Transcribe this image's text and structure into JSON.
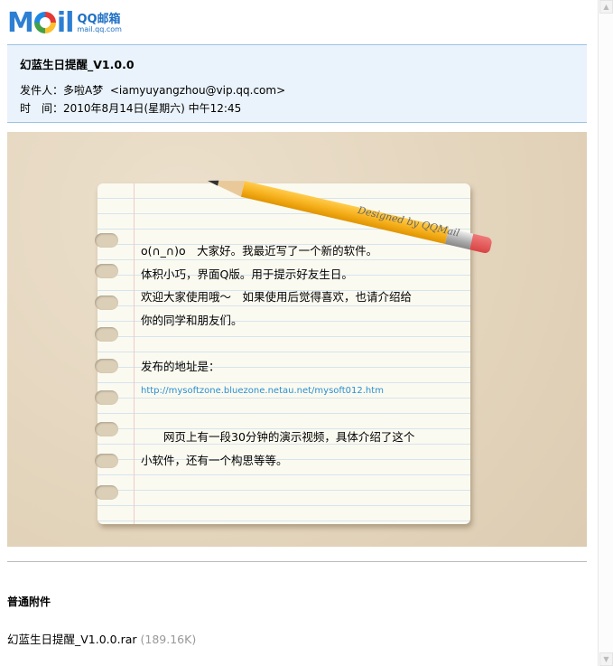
{
  "logo": {
    "brand": "Mail",
    "product": "QQ邮箱",
    "url": "mail.qq.com"
  },
  "email": {
    "subject": "幻蓝生日提醒_V1.0.0",
    "from_label": "发件人：",
    "from_name": "多啦A梦",
    "from_addr": "<iamyuyangzhou@vip.qq.com>",
    "time_label": "时　间：",
    "time_value": "2010年8月14日(星期六) 中午12:45"
  },
  "stationery": {
    "signature": "Designed by QQMail"
  },
  "body": {
    "line1": "o(∩_∩)o　大家好。我最近写了一个新的软件。",
    "line2": "体积小巧，界面Q版。用于提示好友生日。",
    "line3": "欢迎大家使用哦～　如果使用后觉得喜欢，也请介绍给",
    "line4": "你的同学和朋友们。",
    "line5": "发布的地址是：",
    "link": "http://mysoftzone.bluezone.netau.net/mysoft012.htm",
    "line6": "　　网页上有一段30分钟的演示视频，具体介绍了这个",
    "line7": "小软件，还有一个构思等等。"
  },
  "attachments": {
    "title": "普通附件",
    "files": [
      {
        "name": "幻蓝生日提醒_V1.0.0.rar",
        "size": "(189.16K)"
      }
    ]
  }
}
